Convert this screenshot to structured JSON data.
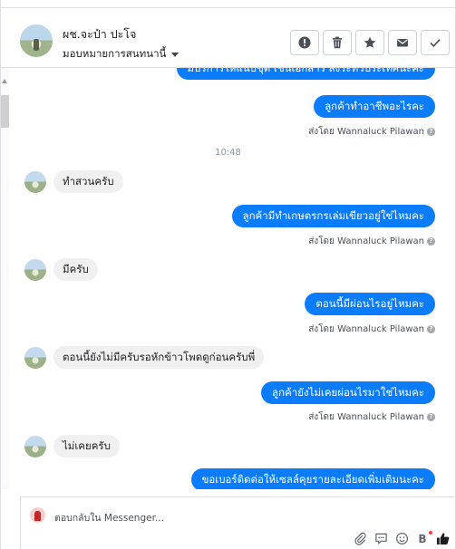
{
  "header": {
    "name": "ผช.จะป๋า ปะโจ",
    "assign_label": "มอบหมายการสนทนานี้",
    "actions": [
      {
        "icon": "alert-icon",
        "label": "mark-spam"
      },
      {
        "icon": "trash-icon",
        "label": "delete"
      },
      {
        "icon": "star-icon",
        "label": "star"
      },
      {
        "icon": "envelope-icon",
        "label": "mark-unread"
      },
      {
        "icon": "check-icon",
        "label": "mark-done"
      }
    ]
  },
  "messages": {
    "out_0": "มีบริการให้แนบชุด เช่นเอกสาร สิงระทิวประเทศนะคะ",
    "out_1": "ลูกค้าทำอาชีพอะไรคะ",
    "sent_by_1": "ส่งโดย Wannaluck Pilawan",
    "time": "10:48",
    "in_1": "ทำสวนครับ",
    "out_2": "ลูกค้ามีทำเกษตรกรเล่มเขียวอยู่ใช่ไหมคะ",
    "sent_by_2": "ส่งโดย Wannaluck Pilawan",
    "in_2": "มีครับ",
    "out_3": "ตอนนี้มีผ่อนไรอยู่ไหมคะ",
    "sent_by_3": "ส่งโดย Wannaluck Pilawan",
    "in_3": "ตอนนี้ยังไม่มีครับรอหักข้าวโพดดูก่อนครับพี่",
    "out_4": "ลูกค้ายังไม่เคยผ่อนไรมาใช่ไหมคะ",
    "sent_by_4": "ส่งโดย Wannaluck Pilawan",
    "in_4": "ไม่เคยครับ",
    "out_5": "ขอเบอร์ติดต่อให้เซลล์คุยรายละเอียดเพิ่มเติมนะคะ"
  },
  "composer": {
    "placeholder": "ตอบกลับใน Messenger..."
  }
}
